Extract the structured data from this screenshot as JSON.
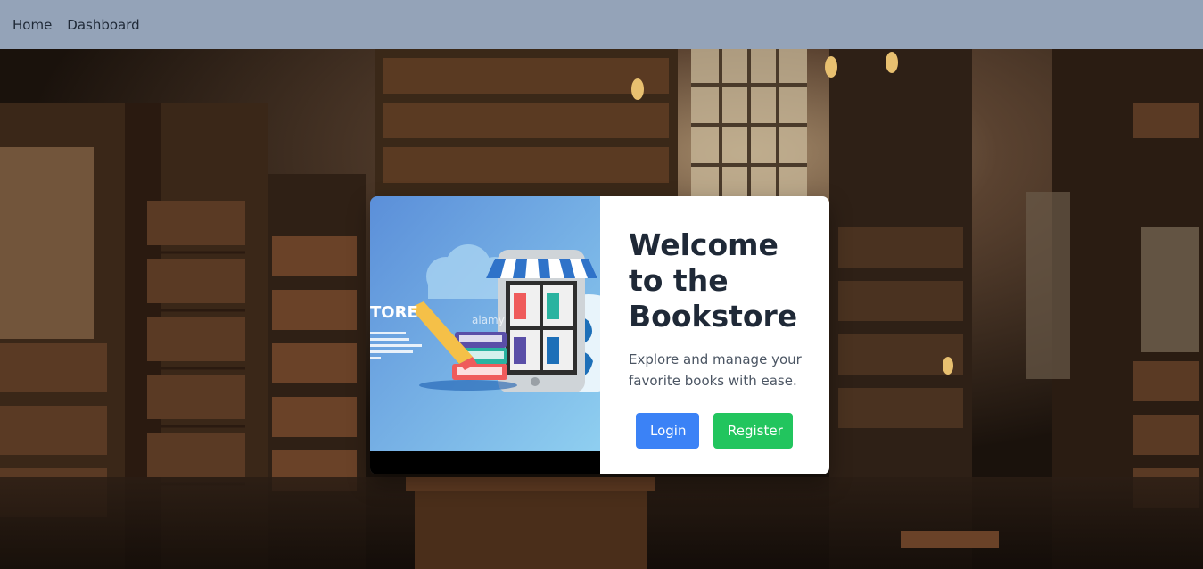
{
  "nav": {
    "items": [
      {
        "label": "Home"
      },
      {
        "label": "Dashboard"
      }
    ]
  },
  "hero": {
    "title": "Welcome to the Bookstore",
    "subtitle": "Explore and manage your favorite books with ease.",
    "login_label": "Login",
    "register_label": "Register"
  },
  "illustration": {
    "store_text": "TORE",
    "watermark": "alamy"
  },
  "colors": {
    "navbar": "#94a3b8",
    "login": "#3b82f6",
    "register": "#22c55e",
    "title": "#1f2937"
  }
}
